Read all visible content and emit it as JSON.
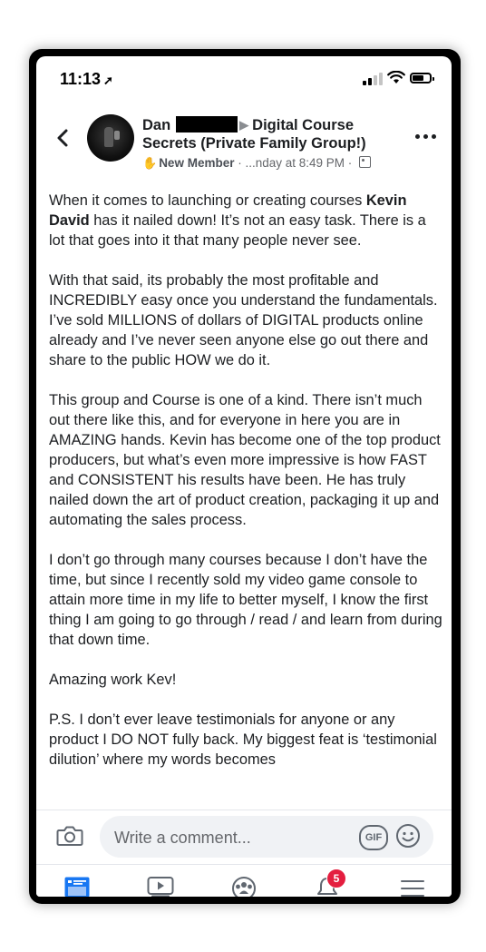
{
  "status_bar": {
    "time": "11:13",
    "time_arrow": "➚"
  },
  "post": {
    "author": "Dan",
    "separator": "▶",
    "group_line1": "Digital Course",
    "group_line2": "Secrets (Private Family Group!)",
    "badge_icon": "✋",
    "member_badge": "New Member",
    "meta_sep": " · ",
    "timestamp": "...nday at 8:49 PM",
    "meta_sep2": " · ",
    "paragraphs": [
      {
        "pre": "When it comes to launching or creating courses ",
        "bold": "Kevin David",
        "post": " has it nailed down! It’s not an easy task. There is a lot that goes into it that many people never see."
      },
      "With that said, its probably the most profitable and INCREDIBLY easy once you understand the fundamentals. I’ve sold MILLIONS of dollars of DIGITAL products online already and I’ve never seen anyone else go out there and share to the public HOW we do it.",
      "This group and Course is one of a kind. There isn’t much out there like this, and for everyone in here you are in AMAZING hands. Kevin has become one of the top product producers, but what’s even more impressive is how FAST and CONSISTENT his results have been. He has truly nailed down the art of product creation, packaging it up and automating the sales process.",
      "I don’t go through many courses because I don’t have the time, but since I recently sold my video game console to attain more time in my life to better myself, I know the first thing I am going to go through / read / and learn from during that down time.",
      "Amazing work Kev!",
      "P.S. I don’t ever leave testimonials for anyone or any product I DO NOT fully back. My biggest feat is ‘testimonial dilution’ where my words becomes"
    ]
  },
  "comment_bar": {
    "placeholder": "Write a comment...",
    "gif_label": "GIF"
  },
  "bottom_nav": {
    "notifications_count": "5",
    "items": [
      "news-feed",
      "watch",
      "groups",
      "notifications",
      "menu"
    ]
  },
  "colors": {
    "accent": "#1877f2",
    "badge": "#e41e3f"
  }
}
